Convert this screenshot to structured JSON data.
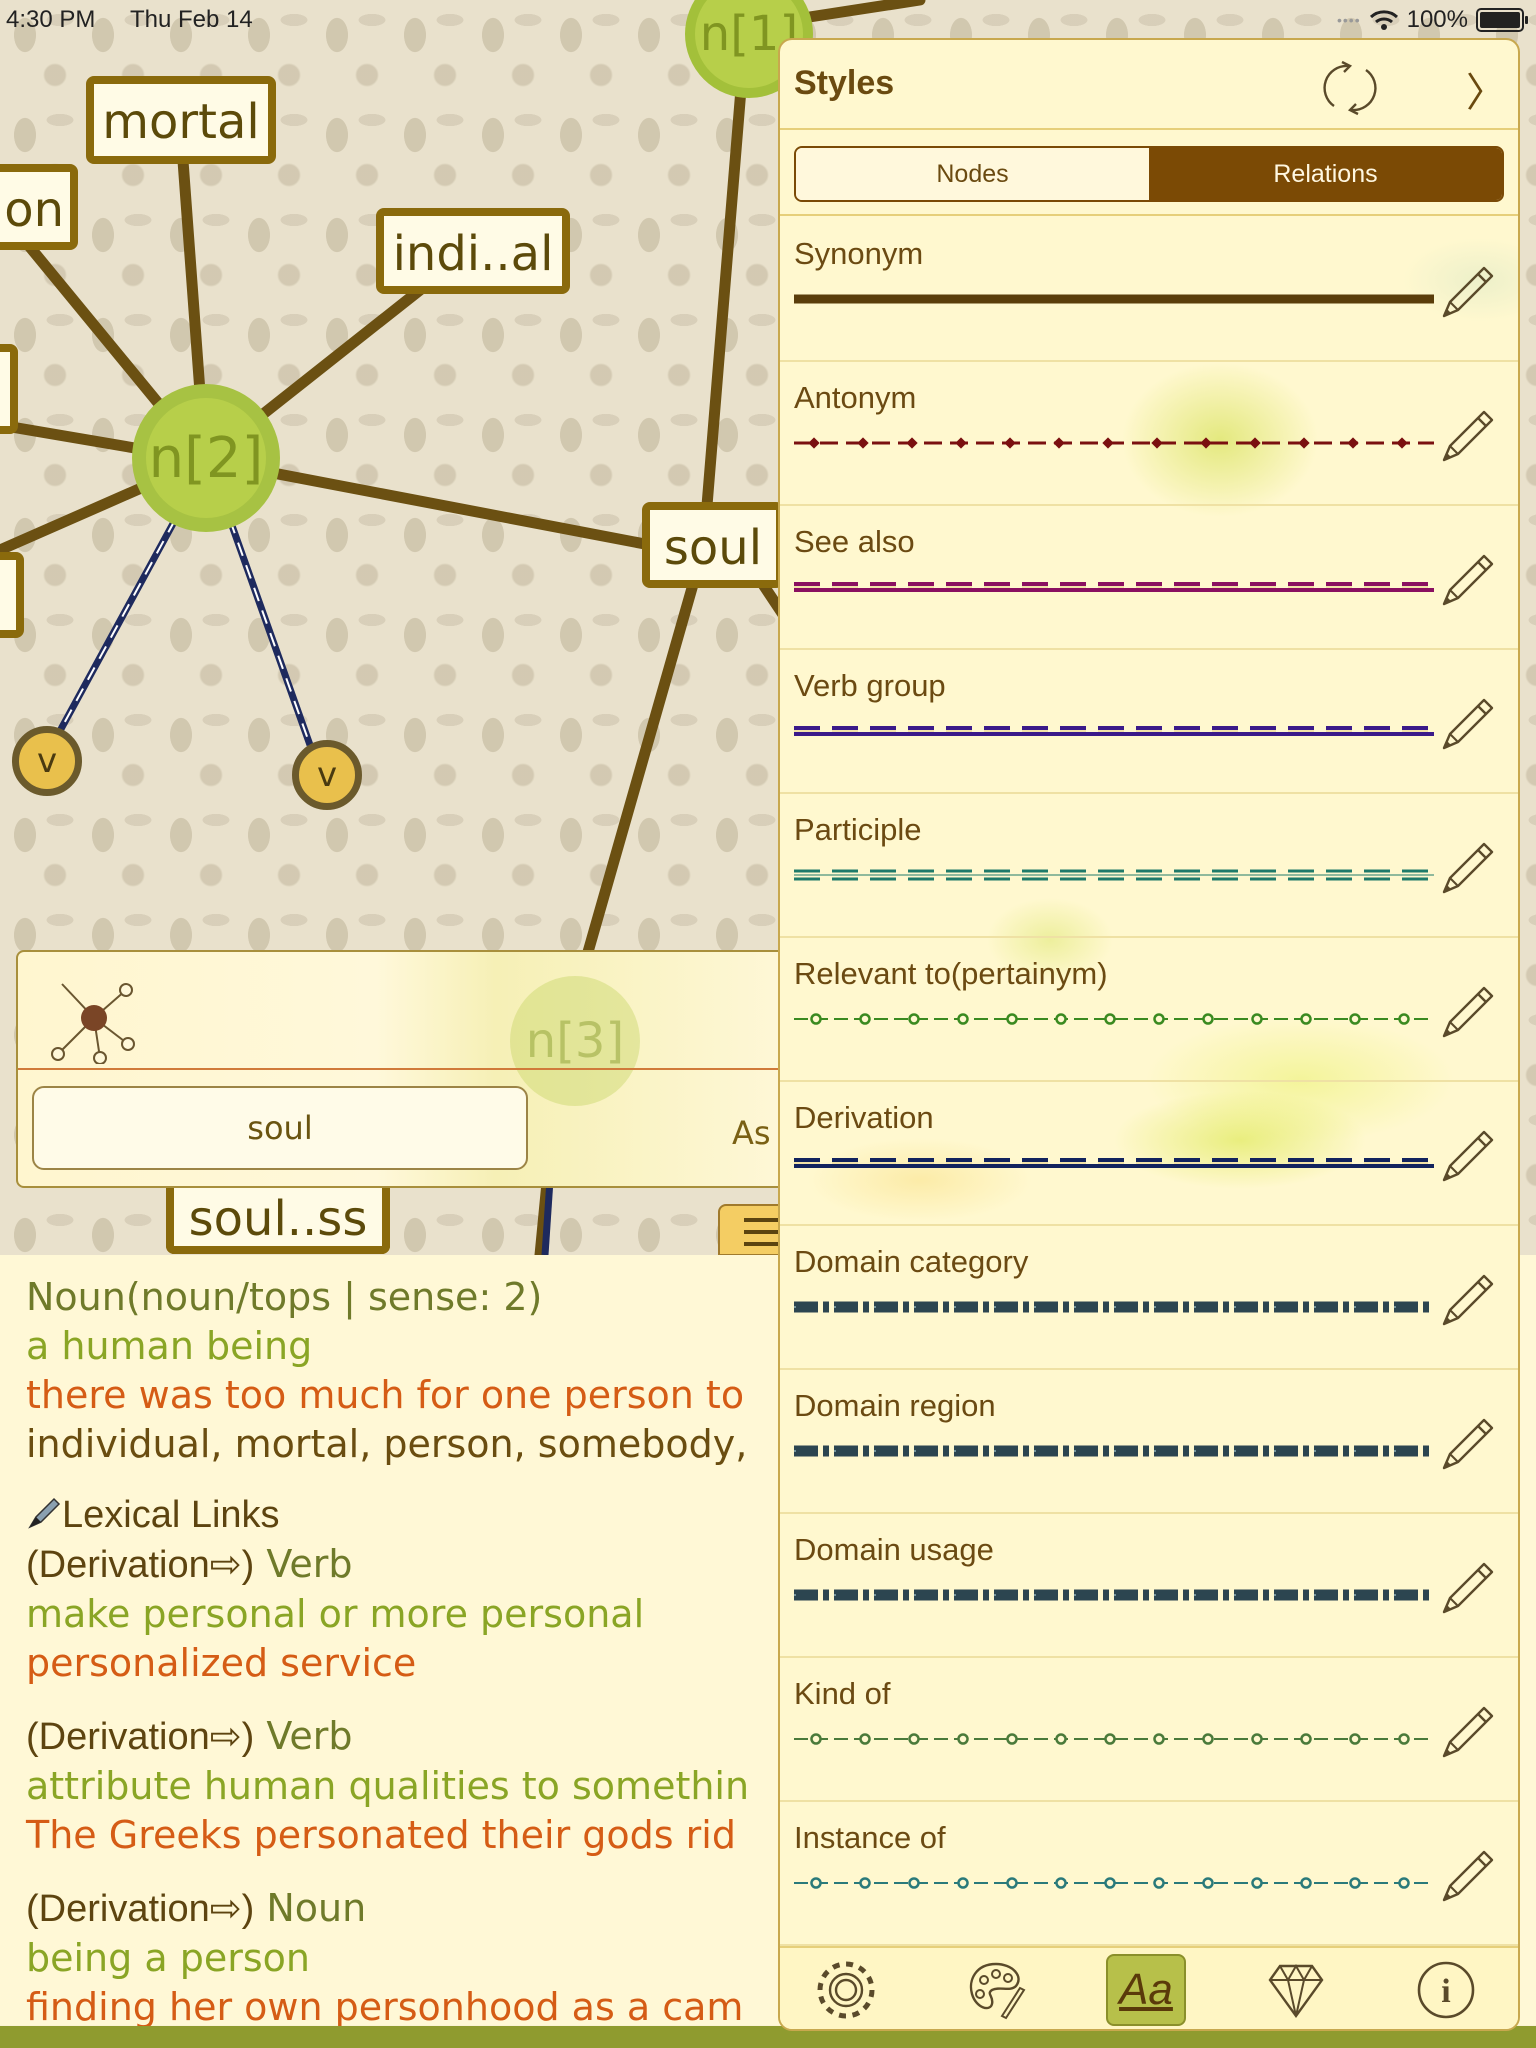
{
  "status_bar": {
    "time": "4:30 PM",
    "date": "Thu Feb 14",
    "battery": "100%"
  },
  "graph": {
    "nodes": {
      "mortal": "mortal",
      "on_partial": "on",
      "individual": "indi..al",
      "soul": "soul",
      "soulness": "soul..ss",
      "n1": "n[1]",
      "n2": "n[2]",
      "n3": "n[3]",
      "v_left": "v",
      "v_right": "v"
    },
    "colors": {
      "edge": "#6b5012",
      "node_border": "#8a6a0c",
      "circle_node": "#b7cf4a",
      "verb_edge": "#1e2a5e"
    }
  },
  "search": {
    "network_icon": "network-icon",
    "query": "soul",
    "ask_partial": "As"
  },
  "details": {
    "header": "Noun(noun/tops | sense: 2)",
    "gloss": "a human being",
    "example": "there was too much for one person to",
    "synonyms": "individual, mortal, person, somebody,",
    "lexical_links_label": "Lexical Links",
    "lexical_links_icon": "pen-icon",
    "links": [
      {
        "relation": "(Derivation⇨)",
        "pos": "Verb",
        "gloss": "make personal or more personal",
        "example": "personalized service"
      },
      {
        "relation": "(Derivation⇨)",
        "pos": "Verb",
        "gloss": "attribute human qualities to somethin",
        "example": "The Greeks personated their gods rid"
      },
      {
        "relation": "(Derivation⇨)",
        "pos": "Noun",
        "gloss": "being a person",
        "example": "finding her own personhood as a cam"
      }
    ]
  },
  "styles_panel": {
    "title": "Styles",
    "refresh_icon": "refresh-icon",
    "close_icon": "chevron-right-icon",
    "close_glyph": "〉",
    "tabs": {
      "nodes": "Nodes",
      "relations": "Relations",
      "selected": "Relations"
    },
    "relations": [
      {
        "label": "Synonym",
        "color": "#5a3d0a",
        "pattern": "solid"
      },
      {
        "label": "Antonym",
        "color": "#7a1010",
        "pattern": "dash-diamond"
      },
      {
        "label": "See also",
        "color": "#8a1060",
        "pattern": "dashed-double"
      },
      {
        "label": "Verb group",
        "color": "#3a1a8a",
        "pattern": "dashed-double"
      },
      {
        "label": "Participle",
        "color": "#1f7a6a",
        "pattern": "double-dash"
      },
      {
        "label": "Relevant to(pertainym)",
        "color": "#3a8a20",
        "pattern": "dash-circle"
      },
      {
        "label": "Derivation",
        "color": "#12235e",
        "pattern": "dashed-double"
      },
      {
        "label": "Domain category",
        "color": "#2c4550",
        "pattern": "thick-dash-dot"
      },
      {
        "label": "Domain region",
        "color": "#2c4550",
        "pattern": "thick-dash-dot"
      },
      {
        "label": "Domain usage",
        "color": "#2c4550",
        "pattern": "thick-dash-dot"
      },
      {
        "label": "Kind of",
        "color": "#4a7a3a",
        "pattern": "dash-circle"
      },
      {
        "label": "Instance of",
        "color": "#2a7a7a",
        "pattern": "dash-circle"
      }
    ],
    "edit_icon": "pencil-icon",
    "tabbar": [
      {
        "name": "settings",
        "icon": "gear-icon"
      },
      {
        "name": "theme",
        "icon": "palette-icon"
      },
      {
        "name": "styles",
        "icon": "font-icon",
        "glyph": "Aa",
        "selected": true
      },
      {
        "name": "premium",
        "icon": "diamond-icon"
      },
      {
        "name": "info",
        "icon": "info-icon",
        "glyph": "i"
      }
    ]
  }
}
